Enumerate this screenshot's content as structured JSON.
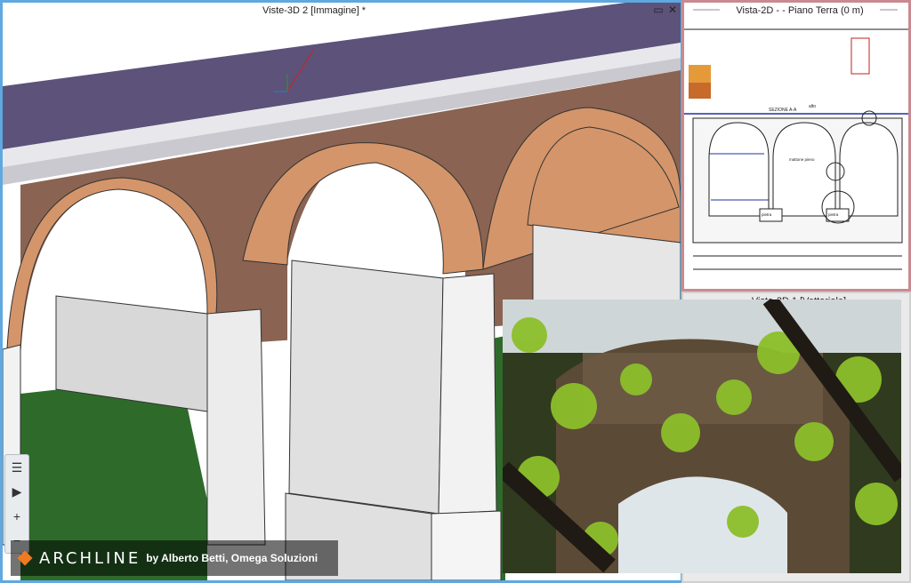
{
  "windows": {
    "main_3d": {
      "title": "Viste-3D 2 [Immagine] *",
      "min": "▭",
      "close": "✕"
    },
    "plan_2d": {
      "title": "Vista-2D  -  - Piano Terra (0 m)"
    },
    "vector_3d": {
      "title": "Viste-3D 1 [Vettoriale]"
    }
  },
  "drawing": {
    "section_label": "SEZIONE A-A",
    "alt_label": "alto",
    "mid_label": "mattone pieno",
    "mid_label_2": "mattone pieno",
    "mid_label_3": "mattone pieno",
    "pier_label": "pietra",
    "pier_label_2": "pietra"
  },
  "toolbox": {
    "list_icon": "☰",
    "play_icon": "▶",
    "plus_icon": "+",
    "minus_icon": "−"
  },
  "brand": {
    "logo_text": "ARCHLINE",
    "byline": "by Alberto Betti, Omega Soluzioni",
    "accent": "#f07a22"
  },
  "colors": {
    "brick": "#8a6352",
    "arch": "#d4956a",
    "roof": "#5d527a",
    "grass": "#2e6b2a",
    "pier": "#e6e6e6"
  }
}
